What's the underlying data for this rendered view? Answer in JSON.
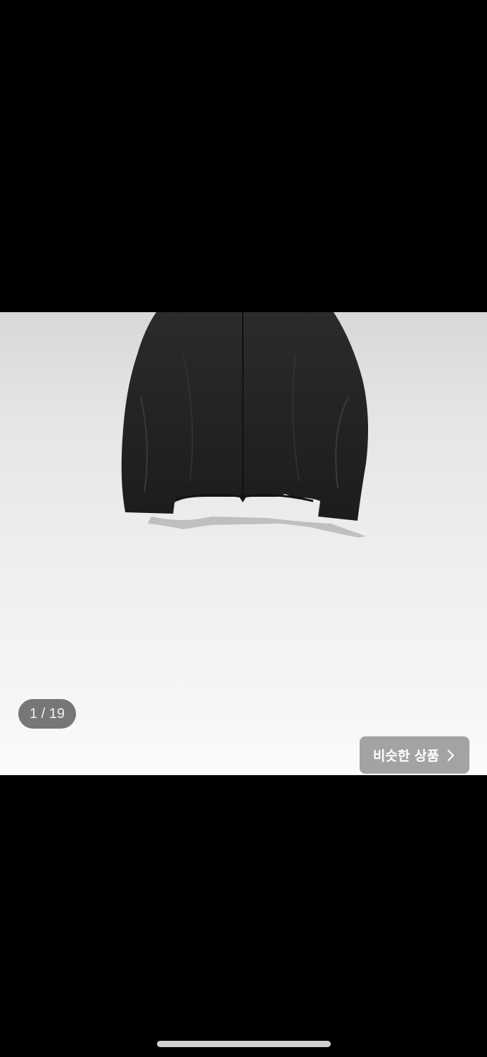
{
  "gallery": {
    "counter_text": "1 / 19",
    "current_index": 1,
    "total_images": 19,
    "image_description_icon": "jacket-photo"
  },
  "similar_button": {
    "label": "비슷한 상품",
    "icon": "chevron-right-icon"
  },
  "colors": {
    "background": "#000000",
    "photo_bg": "#eeeeee",
    "counter_bg": "#5a5a5a",
    "button_bg": "#969696",
    "text_light": "#ffffff"
  }
}
